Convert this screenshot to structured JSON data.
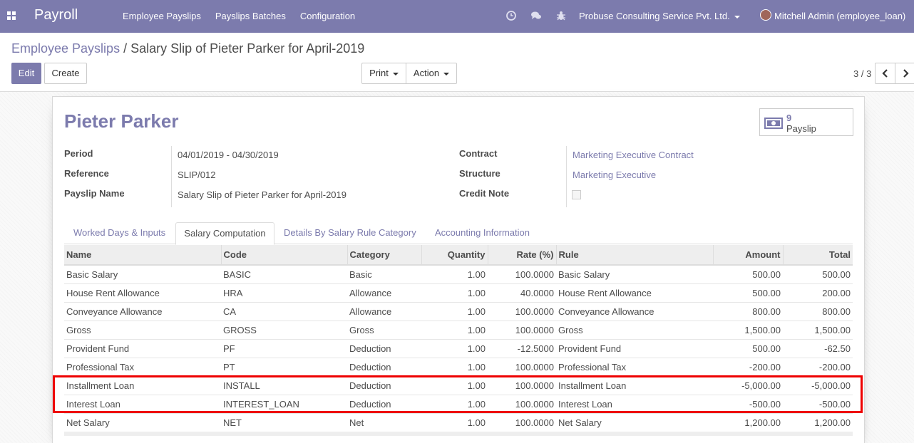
{
  "navbar": {
    "brand": "Payroll",
    "menu": [
      "Employee Payslips",
      "Payslips Batches",
      "Configuration"
    ],
    "company": "Probuse Consulting Service Pvt. Ltd.",
    "user": "Mitchell Admin (employee_loan)",
    "accent_color": "#7c7bad"
  },
  "breadcrumb": {
    "parent": "Employee Payslips",
    "separator": "/",
    "current": "Salary Slip of Pieter Parker for April-2019"
  },
  "toolbar": {
    "edit_label": "Edit",
    "create_label": "Create",
    "print_label": "Print",
    "action_label": "Action",
    "pager": "3 / 3"
  },
  "form": {
    "employee": "Pieter Parker",
    "smart_button": {
      "count": "9",
      "label": "Payslip",
      "icon": "money-icon"
    },
    "left_fields": [
      {
        "label": "Period",
        "value": "04/01/2019 - 04/30/2019"
      },
      {
        "label": "Reference",
        "value": "SLIP/012"
      },
      {
        "label": "Payslip Name",
        "value": "Salary Slip of Pieter Parker for April-2019"
      }
    ],
    "right_fields": [
      {
        "label": "Contract",
        "value": "Marketing Executive Contract"
      },
      {
        "label": "Structure",
        "value": "Marketing Executive"
      },
      {
        "label": "Credit Note",
        "value": ""
      }
    ]
  },
  "tabs": [
    "Worked Days & Inputs",
    "Salary Computation",
    "Details By Salary Rule Category",
    "Accounting Information"
  ],
  "active_tab": "Salary Computation",
  "table": {
    "columns": [
      "Name",
      "Code",
      "Category",
      "Quantity",
      "Rate (%)",
      "Rule",
      "Amount",
      "Total"
    ],
    "rows": [
      [
        "Basic Salary",
        "BASIC",
        "Basic",
        "1.00",
        "100.0000",
        "Basic Salary",
        "500.00",
        "500.00"
      ],
      [
        "House Rent Allowance",
        "HRA",
        "Allowance",
        "1.00",
        "40.0000",
        "House Rent Allowance",
        "500.00",
        "200.00"
      ],
      [
        "Conveyance Allowance",
        "CA",
        "Allowance",
        "1.00",
        "100.0000",
        "Conveyance Allowance",
        "800.00",
        "800.00"
      ],
      [
        "Gross",
        "GROSS",
        "Gross",
        "1.00",
        "100.0000",
        "Gross",
        "1,500.00",
        "1,500.00"
      ],
      [
        "Provident Fund",
        "PF",
        "Deduction",
        "1.00",
        "-12.5000",
        "Provident Fund",
        "500.00",
        "-62.50"
      ],
      [
        "Professional Tax",
        "PT",
        "Deduction",
        "1.00",
        "100.0000",
        "Professional Tax",
        "-200.00",
        "-200.00"
      ],
      [
        "Installment Loan",
        "INSTALL",
        "Deduction",
        "1.00",
        "100.0000",
        "Installment Loan",
        "-5,000.00",
        "-5,000.00"
      ],
      [
        "Interest Loan",
        "INTEREST_LOAN",
        "Deduction",
        "1.00",
        "100.0000",
        "Interest Loan",
        "-500.00",
        "-500.00"
      ],
      [
        "Net Salary",
        "NET",
        "Net",
        "1.00",
        "100.0000",
        "Net Salary",
        "1,200.00",
        "1,200.00"
      ]
    ]
  },
  "highlight_color": "#e00000"
}
